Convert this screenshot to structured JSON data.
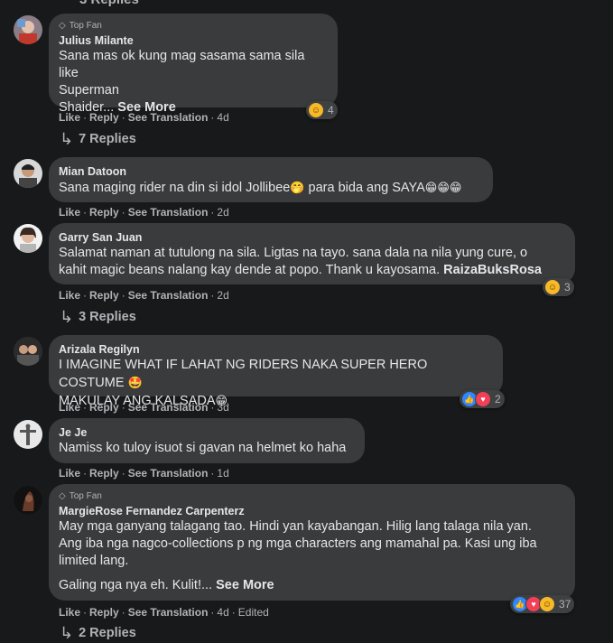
{
  "top_cut": "3 Replies",
  "actions": {
    "like": "Like",
    "reply": "Reply",
    "translate": "See Translation",
    "edited": "Edited"
  },
  "comments": [
    {
      "badge": "Top Fan",
      "author": "Julius Milante",
      "lines": [
        "Sana mas ok kung mag sasama sama sila like",
        "Superman",
        "Shaider..."
      ],
      "see_more": "See More",
      "time": "4d",
      "reaction_count": "4",
      "replies": "7 Replies"
    },
    {
      "author": "Mian Datoon",
      "text": "Sana maging rider na din si idol Jollibee",
      "text_tail": " para bida ang SAYA",
      "time": "2d"
    },
    {
      "author": "Garry San Juan",
      "lines": [
        "Salamat naman at tutulong na sila. Ligtas na tayo. sana dala na nila yung cure, o",
        "kahit magic beans nalang kay dende at popo. Thank u kayosama."
      ],
      "mention": "RaizaBuksRosa",
      "time": "2d",
      "reaction_count": "3",
      "replies": "3 Replies"
    },
    {
      "author": "Arizala Regilyn",
      "lines": [
        "I IMAGINE WHAT IF LAHAT NG RIDERS NAKA SUPER HERO COSTUME",
        "MAKULAY ANG KALSADA"
      ],
      "time": "3d",
      "reaction_count": "2"
    },
    {
      "author": "Je Je",
      "text": "Namiss ko tuloy isuot si gavan na helmet ko haha",
      "time": "1d"
    },
    {
      "badge": "Top Fan",
      "author": "MargieRose Fernandez Carpenterz",
      "lines": [
        "May mga ganyang talagang tao. Hindi yan kayabangan. Hilig lang talaga nila yan.",
        "Ang iba nga nagco-collections p ng mga characters ang mamahal pa. Kasi ung iba",
        "limited lang.",
        "Galing nga nya eh. Kulit!..."
      ],
      "see_more": "See More",
      "time": "4d",
      "reaction_count": "37",
      "replies": "2 Replies"
    }
  ]
}
